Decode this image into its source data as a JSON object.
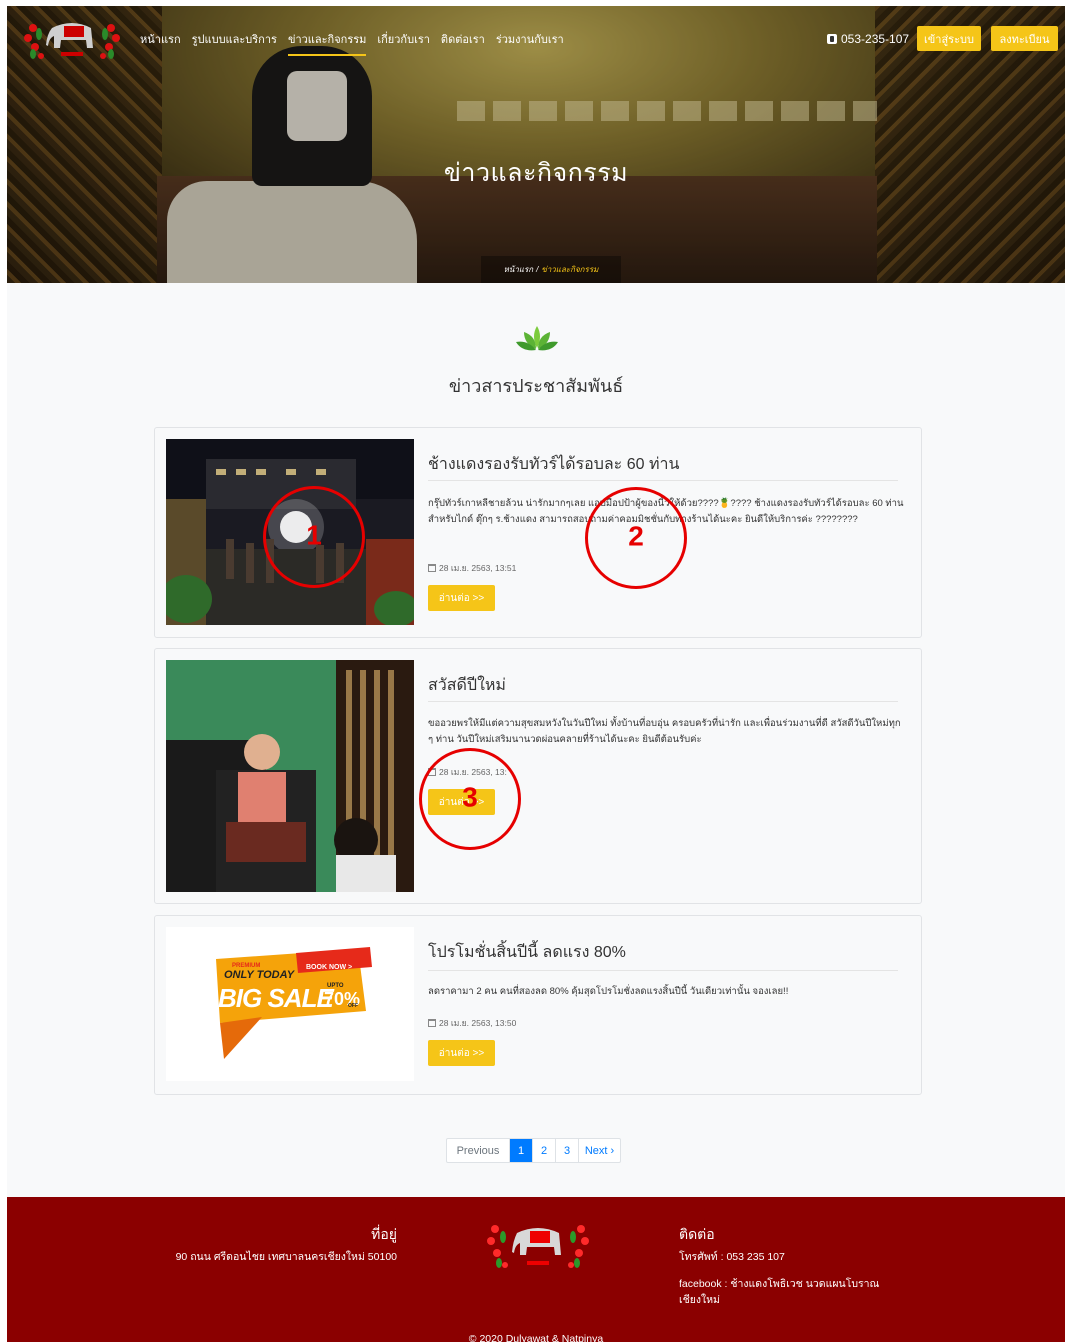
{
  "header": {
    "nav": [
      "หน้าแรก",
      "รูปแบบและบริการ",
      "ข่าวและกิจกรรม",
      "เกี่ยวกับเรา",
      "ติดต่อเรา",
      "ร่วมงานกับเรา"
    ],
    "active_nav_index": 2,
    "phone": "053-235-107",
    "login_label": "เข้าสู่ระบบ",
    "register_label": "ลงทะเบียน",
    "hero_title": "ข่าวและกิจกรรม",
    "breadcrumb_home": "หน้าแรก",
    "breadcrumb_sep": "/",
    "breadcrumb_current": "ข่าวและกิจกรรม"
  },
  "section": {
    "title": "ข่าวสารประชาสัมพันธ์"
  },
  "news": [
    {
      "title": "ช้างแดงรองรับทัวร์ได้รอบละ 60 ท่าน",
      "excerpt": "กรุ๊ปทัวร์เกาหลีชายล้วน น่ารักมากๆเลย แอบมือปป้าผู้ของนี้วให้ด้วย????🍍???? ช้างแดงรองรับทัวร์ได้รอบละ 60 ท่าน สำหรับไกด์ ตุ๊กๆ ร.ช้างแดง สามารถสอบถามค่าคอมมิชชั่นกับทางร้านได้นะคะ ยินดีให้บริการค่ะ ????????",
      "date": "28 เม.ย. 2563, 13:51",
      "read_more": "อ่านต่อ >>"
    },
    {
      "title": "สวัสดีปีใหม่",
      "excerpt": "ขออวยพรให้มีแต่ความสุขสมหวังในวันปีใหม่ ทั้งบ้านที่อบอุ่น ครอบครัวที่น่ารัก และเพื่อนร่วมงานที่ดี สวัสดีวันปีใหม่ทุก ๆ ท่าน วันปีใหม่เสริมนานวดผ่อนคลายที่ร้านได้นะคะ ยินดีต้อนรับค่ะ",
      "date": "28 เม.ย. 2563, 13:",
      "read_more": "อ่านต่อ >>"
    },
    {
      "title": "โปรโมชั่นสิ้นปีนี้ ลดแรง 80%",
      "excerpt": "ลดราคามา 2 คน คนที่สองลด 80% คุ้มสุดโปรโมชั่งลดแรงสิ้นปีนี้ วันเดียวเท่านั้น จองเลย!!",
      "date": "28 เม.ย. 2563, 13:50",
      "read_more": "อ่านต่อ >>",
      "banner": {
        "premium": "PREMIUM",
        "only_today": "ONLY TODAY",
        "book_now": "BOOK NOW >",
        "big_sale": "BIG SALE",
        "upto": "UPTO",
        "percent": "70%",
        "off": "OFF"
      }
    }
  ],
  "annotations": [
    "1",
    "2",
    "3"
  ],
  "pagination": {
    "prev": "Previous",
    "pages": [
      "1",
      "2",
      "3"
    ],
    "active": "1",
    "next": "Next ›"
  },
  "footer": {
    "address_heading": "ที่อยู่",
    "address": "90 ถนน ศรีดอนไชย เทศบาลนครเชียงใหม่ 50100",
    "contact_heading": "ติดต่อ",
    "tel": "โทรศัพท์ : 053 235 107",
    "facebook": "facebook : ช้างแดงโพธิเวช นวดแผนโบราณ เชียงใหม่",
    "copyright": "© 2020 Dulyawat & Natpinya"
  },
  "colors": {
    "accent": "#f5c518",
    "footer": "#8b0000",
    "pager_active": "#007bff",
    "annotation": "#e60000"
  }
}
